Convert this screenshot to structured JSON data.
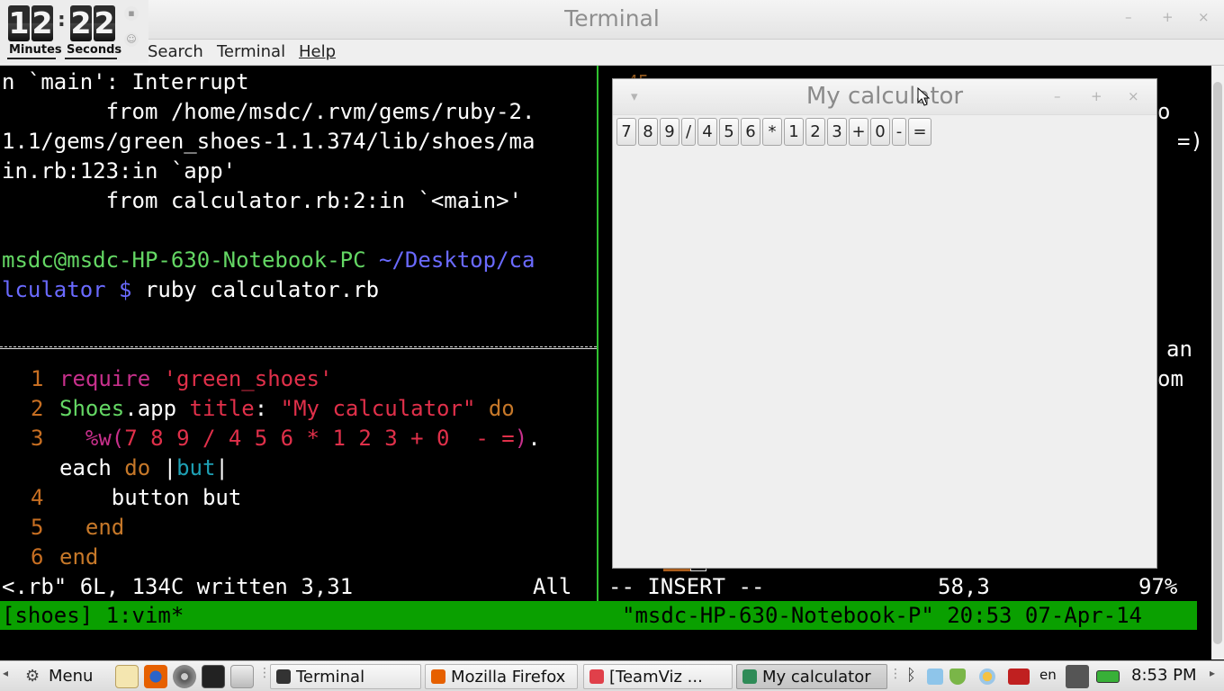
{
  "window": {
    "title": "Terminal",
    "controls": {
      "minimize": "–",
      "maximize": "+",
      "close": "×"
    }
  },
  "clock": {
    "digits": [
      "1",
      "2",
      "2",
      "2"
    ],
    "separator": ":",
    "minutes_label": "Minutes",
    "seconds_label": "Seconds"
  },
  "menu": {
    "items": [
      "Search",
      "Terminal",
      "Help"
    ]
  },
  "left_pane": {
    "output": [
      "n `main': Interrupt",
      "        from /home/msdc/.rvm/gems/ruby-2.",
      "1.1/gems/green_shoes-1.1.374/lib/shoes/ma",
      "in.rb:123:in `app'",
      "        from calculator.rb:2:in `<main>'"
    ],
    "prompt_user": "msdc@msdc-HP-630-Notebook-PC",
    "prompt_path_a": " ~/Desktop/ca",
    "prompt_path_b": "lculator",
    "prompt_symbol": " $",
    "command": " ruby calculator.rb"
  },
  "vim": {
    "lines": [
      {
        "num": "1",
        "tokens": [
          [
            "mag",
            "require "
          ],
          [
            "red",
            "'green_shoes'"
          ]
        ]
      },
      {
        "num": "2",
        "tokens": [
          [
            "green",
            "Shoes"
          ],
          [
            "white",
            ".app "
          ],
          [
            "red",
            "title"
          ],
          [
            "white",
            ": "
          ],
          [
            "red",
            "\"My calculator\""
          ],
          [
            "orange",
            " do"
          ]
        ]
      },
      {
        "num": "3",
        "tokens": [
          [
            "white",
            "  "
          ],
          [
            "mag",
            "%w("
          ],
          [
            "red",
            "7 8 9 / 4 5 6 * 1 2 3 + 0  - ="
          ],
          [
            "mag",
            ")"
          ],
          [
            "white",
            "."
          ]
        ]
      },
      {
        "num": "",
        "tokens": [
          [
            "white",
            "each "
          ],
          [
            "orange",
            "do"
          ],
          [
            "white",
            " |"
          ],
          [
            "teal",
            "but"
          ],
          [
            "white",
            "|"
          ]
        ]
      },
      {
        "num": "4",
        "tokens": [
          [
            "white",
            "    button but"
          ]
        ]
      },
      {
        "num": "5",
        "tokens": [
          [
            "orange",
            "  end"
          ]
        ]
      },
      {
        "num": "6",
        "tokens": [
          [
            "orange",
            "end"
          ]
        ]
      }
    ],
    "left_status": "<.rb\" 6L, 134C written 3,31",
    "left_status_right": "All",
    "right_status_mode": "-- INSERT --",
    "right_status_pos": "58,3",
    "right_status_pct": "97%",
    "right_fragments": [
      "45",
      "o",
      "=)",
      "an",
      "om"
    ]
  },
  "tmux": {
    "left": "[shoes] 1:vim*",
    "right": "\"msdc-HP-630-Notebook-P\" 20:53 07-Apr-14"
  },
  "calculator": {
    "title": "My calculator",
    "controls": {
      "menu": "▾",
      "minimize": "–",
      "maximize": "+",
      "close": "×"
    },
    "buttons": [
      "7",
      "8",
      "9",
      "/",
      "4",
      "5",
      "6",
      "*",
      "1",
      "2",
      "3",
      "+",
      "0",
      "-",
      "="
    ]
  },
  "taskbar": {
    "menu_label": "Menu",
    "tasks": [
      {
        "label": "Terminal",
        "icon": "terminal-icon",
        "color": "#333333"
      },
      {
        "label": "Mozilla Firefox",
        "icon": "firefox-icon",
        "color": "#e66000"
      },
      {
        "label": "[TeamViz ...",
        "icon": "tomato-icon",
        "color": "#e0404a"
      },
      {
        "label": "My calculator",
        "icon": "shoes-icon",
        "color": "#2e8b57"
      }
    ],
    "language": "en",
    "time": "8:53 PM"
  }
}
